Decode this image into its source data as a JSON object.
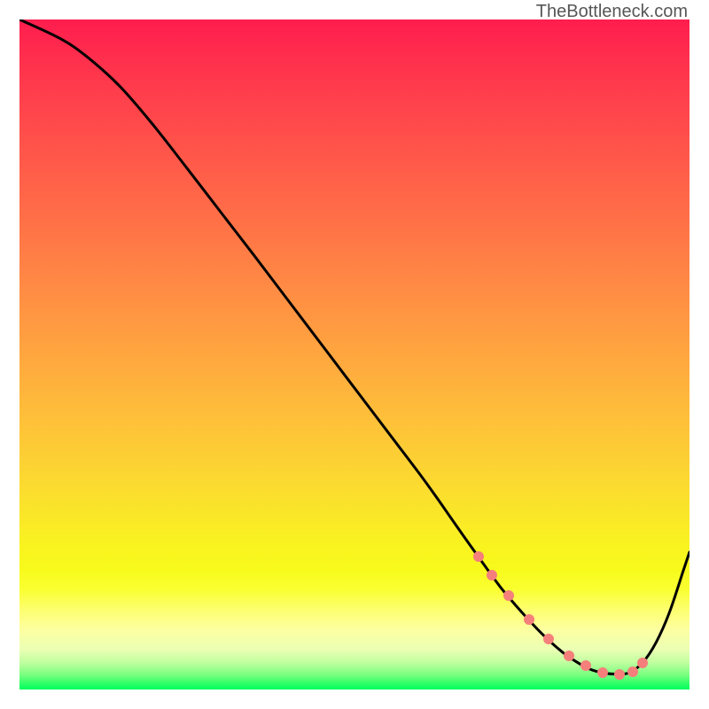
{
  "watermark": "TheBottleneck.com",
  "colors": {
    "dot_fill": "#f57f7b",
    "curve_stroke": "#000000"
  },
  "chart_data": {
    "type": "line",
    "title": "",
    "xlabel": "",
    "ylabel": "",
    "xlim": [
      0,
      100
    ],
    "ylim": [
      0,
      100
    ],
    "gradient_stops": [
      {
        "offset": 0.0,
        "color": "#ff1d4e"
      },
      {
        "offset": 0.1,
        "color": "#ff3b4c"
      },
      {
        "offset": 0.2,
        "color": "#ff564a"
      },
      {
        "offset": 0.3,
        "color": "#ff7047"
      },
      {
        "offset": 0.4,
        "color": "#ff8b44"
      },
      {
        "offset": 0.5,
        "color": "#ffa63f"
      },
      {
        "offset": 0.6,
        "color": "#fec139"
      },
      {
        "offset": 0.7,
        "color": "#fbdc2f"
      },
      {
        "offset": 0.78,
        "color": "#f9f221"
      },
      {
        "offset": 0.82,
        "color": "#f8fa1b"
      },
      {
        "offset": 0.85,
        "color": "#faff30"
      },
      {
        "offset": 0.88,
        "color": "#fdff6e"
      },
      {
        "offset": 0.91,
        "color": "#fdffa0"
      },
      {
        "offset": 0.94,
        "color": "#ebffb4"
      },
      {
        "offset": 0.96,
        "color": "#bfff9f"
      },
      {
        "offset": 0.978,
        "color": "#7aff80"
      },
      {
        "offset": 0.99,
        "color": "#34ff69"
      },
      {
        "offset": 1.0,
        "color": "#00ff5e"
      }
    ],
    "series": [
      {
        "name": "bottleneck-curve",
        "x": [
          0.0,
          6.0,
          10.0,
          15.0,
          20.0,
          25.0,
          30.0,
          35.0,
          40.0,
          45.0,
          50.0,
          55.0,
          60.0,
          63.0,
          66.0,
          69.0,
          72.0,
          75.0,
          78.0,
          81.0,
          83.0,
          85.0,
          87.0,
          89.0,
          91.0,
          93.0,
          95.0,
          97.0,
          99.0,
          100.0
        ],
        "y": [
          100.0,
          97.2,
          94.5,
          90.0,
          84.2,
          77.8,
          71.3,
          64.8,
          58.2,
          51.6,
          45.0,
          38.4,
          31.8,
          27.6,
          23.3,
          19.1,
          15.0,
          11.5,
          8.3,
          5.6,
          4.2,
          3.1,
          2.5,
          2.3,
          2.5,
          4.0,
          7.0,
          11.5,
          17.5,
          20.5
        ]
      }
    ],
    "highlight_points": {
      "name": "optimal-range-dots",
      "x": [
        68.5,
        70.5,
        73.0,
        76.0,
        79.0,
        82.0,
        84.5,
        87.0,
        89.5,
        91.5,
        93.0
      ],
      "y": [
        19.8,
        17.0,
        14.0,
        10.5,
        7.5,
        5.0,
        3.6,
        2.5,
        2.3,
        2.7,
        4.0
      ]
    }
  }
}
